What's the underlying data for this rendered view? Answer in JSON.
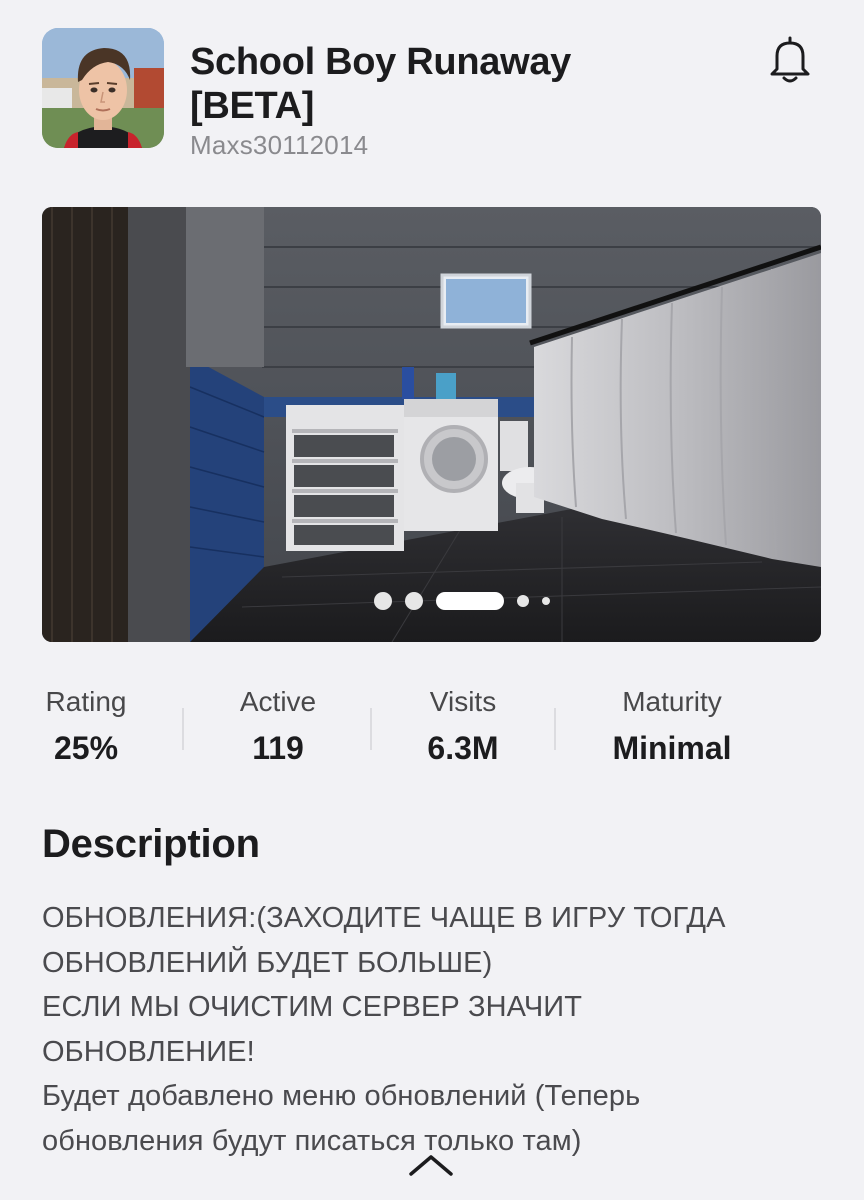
{
  "game": {
    "title_line1": "School Boy Runaway",
    "title_line2": "[BETA]",
    "creator": "Maxs30112014"
  },
  "carousel": {
    "slide_count": 5,
    "active_index": 2
  },
  "stats": [
    {
      "label": "Rating",
      "value": "25%"
    },
    {
      "label": "Active",
      "value": "119"
    },
    {
      "label": "Visits",
      "value": "6.3M"
    },
    {
      "label": "Maturity",
      "value": "Minimal"
    }
  ],
  "description": {
    "heading": "Description",
    "lines": [
      "ОБНОВЛЕНИЯ:(ЗАХОДИТЕ ЧАЩЕ В ИГРУ ТОГДА",
      "ОБНОВЛЕНИЙ БУДЕТ БОЛЬШЕ)",
      "ЕСЛИ МЫ ОЧИСТИМ СЕРВЕР ЗНАЧИТ",
      "ОБНОВЛЕНИЕ!",
      "Будет добавлено меню обновлений (Теперь",
      "обновления будут писаться только там)"
    ]
  },
  "icons": {
    "notify": "bell-icon",
    "collapse": "chevron-up-icon"
  },
  "colors": {
    "background": "#f2f2f5",
    "text_primary": "#1c1c1e",
    "text_secondary": "#8a8a8e"
  }
}
